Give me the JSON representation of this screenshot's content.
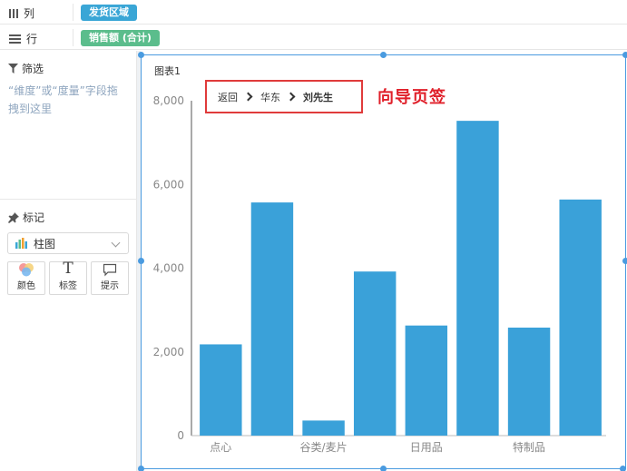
{
  "shelves": {
    "columns": {
      "label": "列",
      "pill": "发货区域",
      "pill_color": "#3aa6d6"
    },
    "rows": {
      "label": "行",
      "pill": "销售额 (合计)",
      "pill_color": "#5bbd8c"
    }
  },
  "filter_panel": {
    "title": "筛选",
    "hint": "“维度”或“度量”字段拖拽到这里"
  },
  "marks_panel": {
    "title": "标记",
    "chart_type": "柱图",
    "buttons": [
      {
        "label": "颜色",
        "icon": "color-palette-icon"
      },
      {
        "label": "标签",
        "icon": "text-label-icon"
      },
      {
        "label": "提示",
        "icon": "tooltip-icon"
      }
    ]
  },
  "chart": {
    "title": "图表1",
    "breadcrumb": {
      "back": "返回",
      "path": [
        "华东",
        "刘先生"
      ]
    },
    "annotation": "向导页签",
    "bar_color": "#3aa1d9"
  },
  "chart_data": {
    "type": "bar",
    "title": "图表1",
    "categories": [
      "点心",
      "",
      "谷类/麦片",
      "",
      "日用品",
      "",
      "特制品",
      ""
    ],
    "x_tick_labels": [
      "点心",
      "谷类/麦片",
      "日用品",
      "特制品"
    ],
    "values": [
      2180,
      5570,
      360,
      3920,
      2630,
      7520,
      2580,
      5640
    ],
    "ylim": [
      0,
      8000
    ],
    "y_ticks": [
      0,
      2000,
      4000,
      6000,
      8000
    ],
    "y_tick_labels": [
      "0",
      "2,000",
      "4,000",
      "6,000",
      "8,000"
    ],
    "xlabel": "",
    "ylabel": "",
    "grid": false,
    "legend": "none"
  }
}
